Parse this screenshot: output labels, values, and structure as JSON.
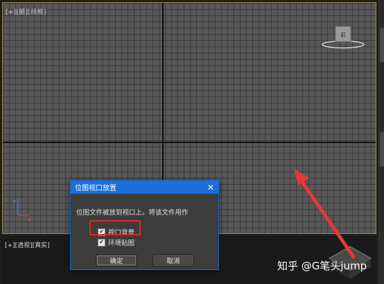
{
  "viewport_top": {
    "label_prefix": "[+]",
    "label_view": "[前]",
    "label_shading": "[线框]"
  },
  "viewport_bottom": {
    "label_prefix": "[+]",
    "label_view": "[透视]",
    "label_shading": "[真实]"
  },
  "viewcube": {
    "face_label": "前"
  },
  "dialog": {
    "title": "位图视口放置",
    "close_glyph": "✕",
    "message": "位图文件被放到视口上。将该文件用作",
    "option_viewport_bg": {
      "label": "视口背景",
      "checked": true
    },
    "option_env_map": {
      "label": "环境贴图",
      "checked": true
    },
    "ok_label": "确定",
    "cancel_label": "取消"
  },
  "check_glyph": "✔",
  "watermark": "知乎 @G笔头jump",
  "colors": {
    "grid_bg": "#575757",
    "dialog_title": "#1e6ed8",
    "highlight": "#e02424",
    "arrow": "#e53935"
  }
}
